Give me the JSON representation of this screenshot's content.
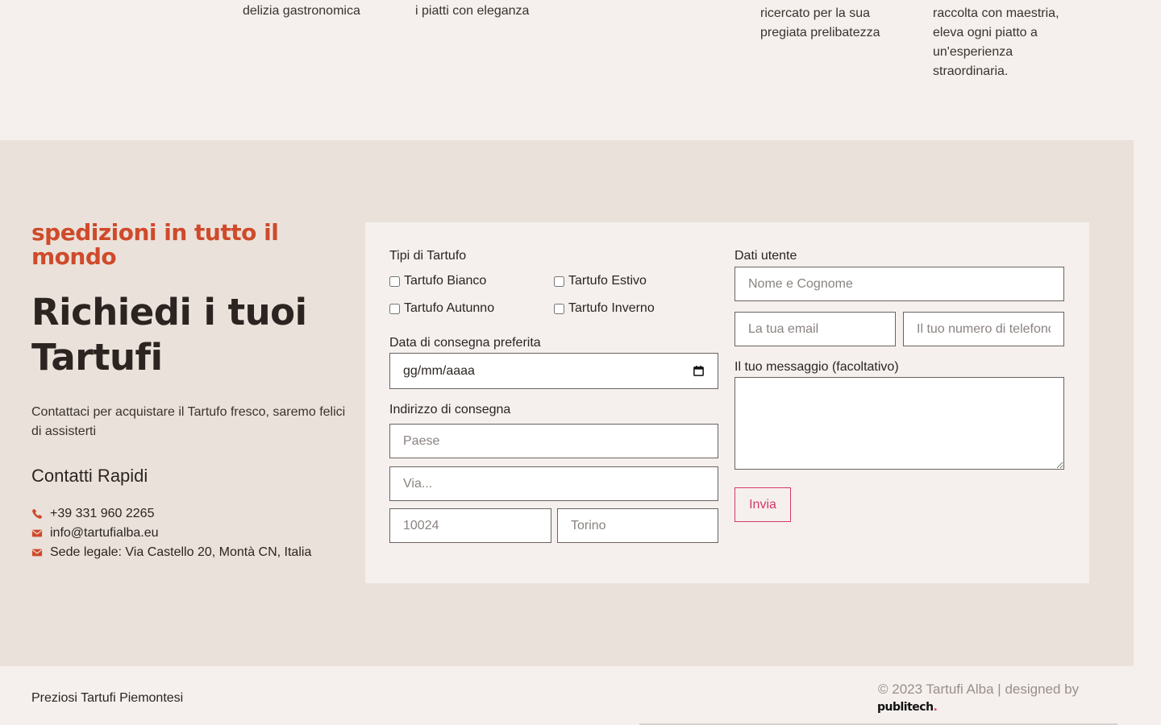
{
  "top_columns": [
    [
      "delizia gastronomica"
    ],
    [
      "i piatti con eleganza"
    ],
    [
      "ricercato per la sua",
      "pregiata prelibatezza"
    ],
    [
      "raccolta con maestria,",
      "eleva ogni piatto a",
      "un'esperienza",
      "straordinaria."
    ]
  ],
  "contact": {
    "kicker": "spedizioni in tutto il mondo",
    "title": "Richiedi i tuoi Tartufi",
    "lead": "Contattaci per acquistare il Tartufo fresco, saremo felici di assisterti",
    "quick_title": "Contatti Rapidi",
    "items": [
      {
        "icon": "phone-icon",
        "text": "+39 331 960 2265"
      },
      {
        "icon": "envelope-icon",
        "text": "info@tartufialba.eu"
      },
      {
        "icon": "envelope-icon",
        "text": "Sede legale: Via Castello 20, Montà CN, Italia"
      }
    ],
    "accent_color": "#cf4a2b"
  },
  "form": {
    "types_label": "Tipi di Tartufo",
    "types": [
      "Tartufo Bianco",
      "Tartufo Estivo",
      "Tartufo Autunno",
      "Tartufo Inverno"
    ],
    "date_label": "Data di consegna preferita",
    "date_value": "gg/mm/aaaa",
    "address_label": "Indirizzo di consegna",
    "country_placeholder": "Paese",
    "street_placeholder": "Via...",
    "zip_placeholder": "10024",
    "city_placeholder": "Torino",
    "user_label": "Dati utente",
    "name_placeholder": "Nome e Cognome",
    "email_placeholder": "La tua email",
    "phone_placeholder": "Il tuo numero di telefono",
    "message_label": "Il tuo messaggio (facoltativo)",
    "submit_label": "Invia",
    "submit_color": "#d6376f"
  },
  "footer": {
    "tagline": "Preziosi Tartufi Piemontesi",
    "copyright": "© 2023 Tartufi Alba | designed by",
    "brand": "publitech",
    "brand_dot": "."
  }
}
